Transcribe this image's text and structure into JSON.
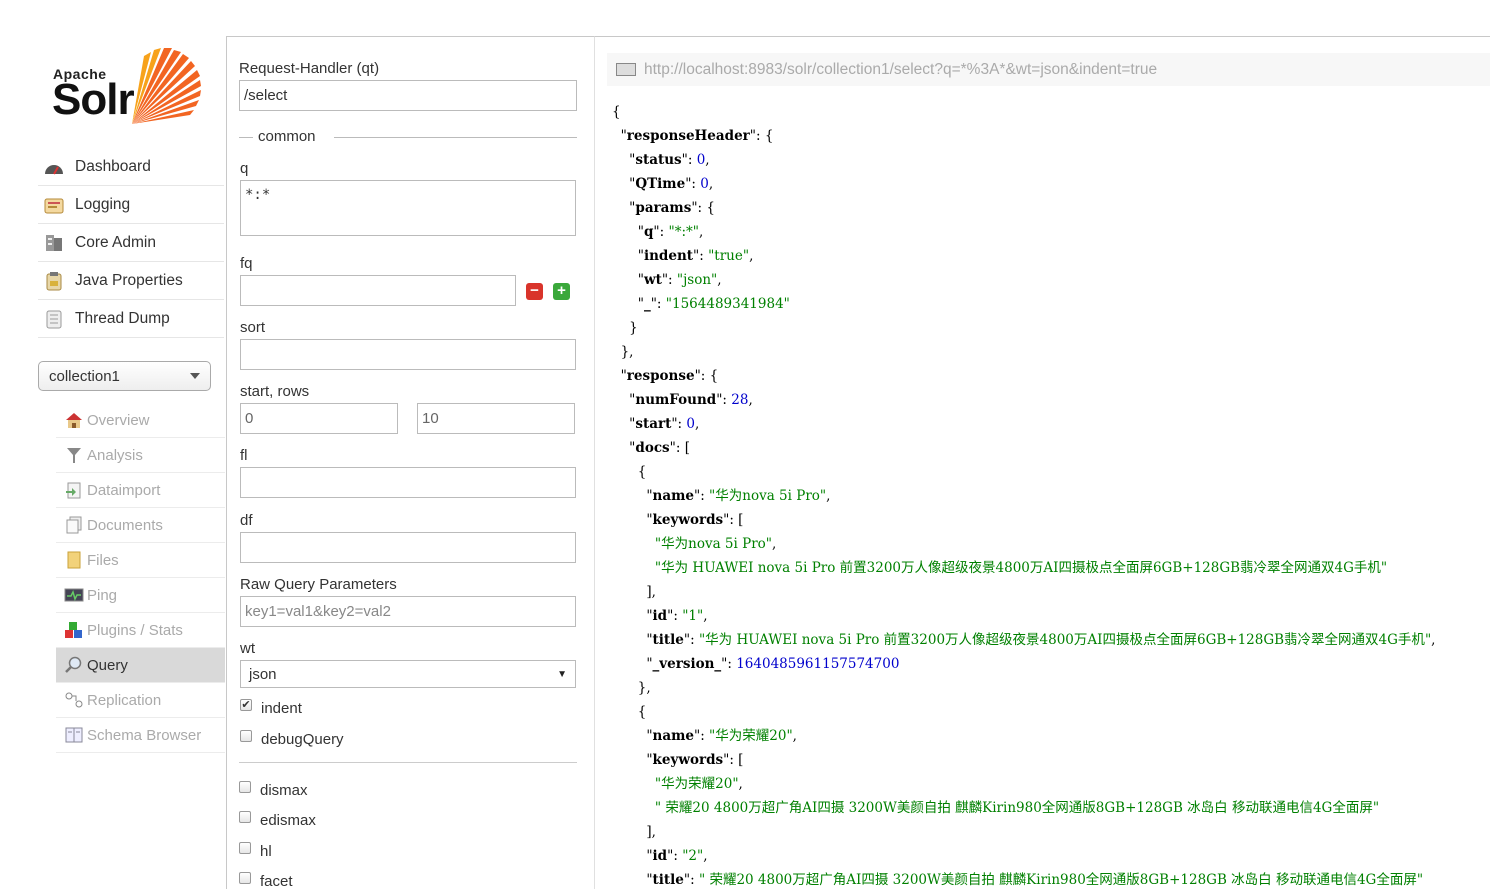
{
  "logo": {
    "apache": "Apache",
    "solr": "Solr"
  },
  "main_nav": [
    {
      "label": "Dashboard",
      "icon": "dashboard-icon"
    },
    {
      "label": "Logging",
      "icon": "logging-icon"
    },
    {
      "label": "Core Admin",
      "icon": "core-admin-icon"
    },
    {
      "label": "Java Properties",
      "icon": "java-icon"
    },
    {
      "label": "Thread Dump",
      "icon": "thread-dump-icon"
    }
  ],
  "core_selector": {
    "value": "collection1"
  },
  "core_nav": [
    {
      "label": "Overview",
      "icon": "overview-icon"
    },
    {
      "label": "Analysis",
      "icon": "analysis-icon"
    },
    {
      "label": "Dataimport",
      "icon": "dataimport-icon"
    },
    {
      "label": "Documents",
      "icon": "documents-icon"
    },
    {
      "label": "Files",
      "icon": "files-icon"
    },
    {
      "label": "Ping",
      "icon": "ping-icon"
    },
    {
      "label": "Plugins / Stats",
      "icon": "plugins-icon"
    },
    {
      "label": "Query",
      "icon": "query-icon",
      "active": true
    },
    {
      "label": "Replication",
      "icon": "replication-icon"
    },
    {
      "label": "Schema Browser",
      "icon": "schema-icon"
    }
  ],
  "form": {
    "qt_label": "Request-Handler (qt)",
    "qt_value": "/select",
    "common_legend": "common",
    "q_label": "q",
    "q_value": "*:*",
    "fq_label": "fq",
    "fq_value": "",
    "sort_label": "sort",
    "sort_value": "",
    "start_rows_label": "start, rows",
    "start_value": "0",
    "rows_value": "10",
    "fl_label": "fl",
    "fl_value": "",
    "df_label": "df",
    "df_value": "",
    "raw_label": "Raw Query Parameters",
    "raw_placeholder": "key1=val1&key2=val2",
    "wt_label": "wt",
    "wt_value": "json",
    "indent_label": "indent",
    "indent_checked": true,
    "debug_label": "debugQuery",
    "dismax_label": "dismax",
    "edismax_label": "edismax",
    "hl_label": "hl",
    "facet_label": "facet"
  },
  "result": {
    "url": "http://localhost:8983/solr/collection1/select?q=*%3A*&wt=json&indent=true",
    "responseHeader": {
      "status": "0",
      "QTime": "0",
      "params": {
        "q": "*:*",
        "indent": "true",
        "wt": "json",
        "_": "1564489341984"
      }
    },
    "response": {
      "numFound": "28",
      "start": "0",
      "docs": [
        {
          "name": "华为nova 5i Pro",
          "keywords": [
            "华为nova 5i Pro",
            "华为 HUAWEI nova 5i Pro 前置3200万人像超级夜景4800万AI四摄极点全面屏6GB+128GB翡冷翠全网通双4G手机"
          ],
          "id": "1",
          "title": "华为 HUAWEI nova 5i Pro 前置3200万人像超级夜景4800万AI四摄极点全面屏6GB+128GB翡冷翠全网通双4G手机",
          "_version_": "1640485961157574700"
        },
        {
          "name": "华为荣耀20",
          "keywords": [
            "华为荣耀20",
            " 荣耀20 4800万超广角AI四摄 3200W美颜自拍 麒麟Kirin980全网通版8GB+128GB 冰岛白 移动联通电信4G全面屏"
          ],
          "id": "2",
          "title": " 荣耀20 4800万超广角AI四摄 3200W美颜自拍 麒麟Kirin980全网通版8GB+128GB 冰岛白 移动联通电信4G全面屏"
        }
      ]
    }
  }
}
